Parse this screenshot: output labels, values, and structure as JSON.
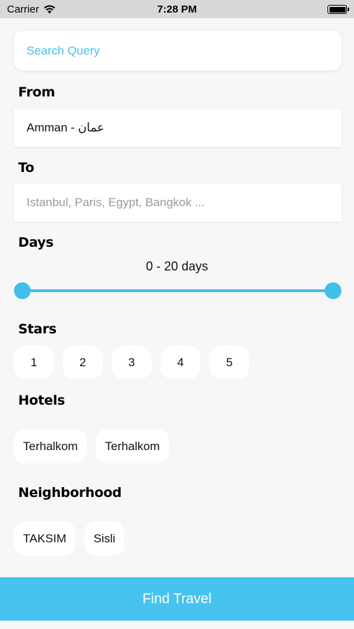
{
  "status_bar": {
    "carrier": "Carrier",
    "time": "7:28 PM"
  },
  "search": {
    "placeholder": "Search Query"
  },
  "from": {
    "label": "From",
    "value": "Amman - عمان"
  },
  "to": {
    "label": "To",
    "placeholder": "Istanbul, Paris, Egypt, Bangkok ..."
  },
  "days": {
    "label": "Days",
    "range_text": "0 - 20 days",
    "min": 0,
    "max": 20
  },
  "stars": {
    "label": "Stars",
    "options": [
      "1",
      "2",
      "3",
      "4",
      "5"
    ]
  },
  "hotels": {
    "label": "Hotels",
    "items": [
      "Terhalkom",
      "Terhalkom"
    ]
  },
  "neighborhood": {
    "label": "Neighborhood",
    "items": [
      "TAKSIM",
      "Sisli"
    ]
  },
  "find_button": {
    "label": "Find Travel"
  },
  "colors": {
    "accent": "#46c3ee",
    "background": "#f7f7f7",
    "status_bar": "#d8d8d8"
  }
}
